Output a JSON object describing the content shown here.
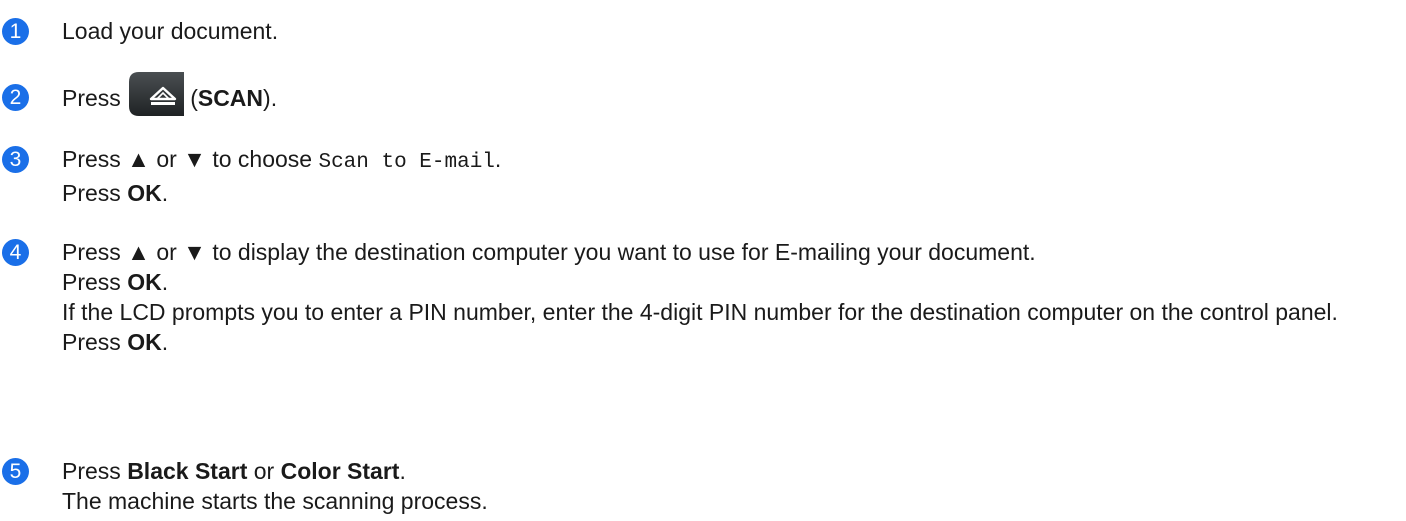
{
  "steps": [
    {
      "number": "1",
      "text": "Load your document."
    },
    {
      "number": "2",
      "prefix": "Press",
      "key_label": "SCAN",
      "open": "(",
      "close": ")."
    },
    {
      "number": "3",
      "line1_a": "Press ▲ or ▼ to choose ",
      "line1_code": "Scan to E-mail",
      "line1_end": ".",
      "line2_a": "Press ",
      "line2_b": "OK",
      "line2_end": "."
    },
    {
      "number": "4",
      "line1": "Press ▲ or ▼ to display the destination computer you want to use for E-mailing your document.",
      "line2_a": "Press ",
      "line2_b": "OK",
      "line2_end": ".",
      "line3": "If the LCD prompts you to enter a PIN number, enter the 4-digit PIN number for the destination computer on the control panel.",
      "line4_a": "Press ",
      "line4_b": "OK",
      "line4_end": "."
    },
    {
      "number": "5",
      "line1_a": "Press ",
      "line1_b": "Black Start",
      "line1_c": " or ",
      "line1_d": "Color Start",
      "line1_end": ".",
      "line2": "The machine starts the scanning process."
    }
  ],
  "icons": {
    "scan_button": "scan-button-icon"
  },
  "colors": {
    "step_number_bg": "#1a6fe8",
    "scan_button_bg": "#2f3336"
  }
}
